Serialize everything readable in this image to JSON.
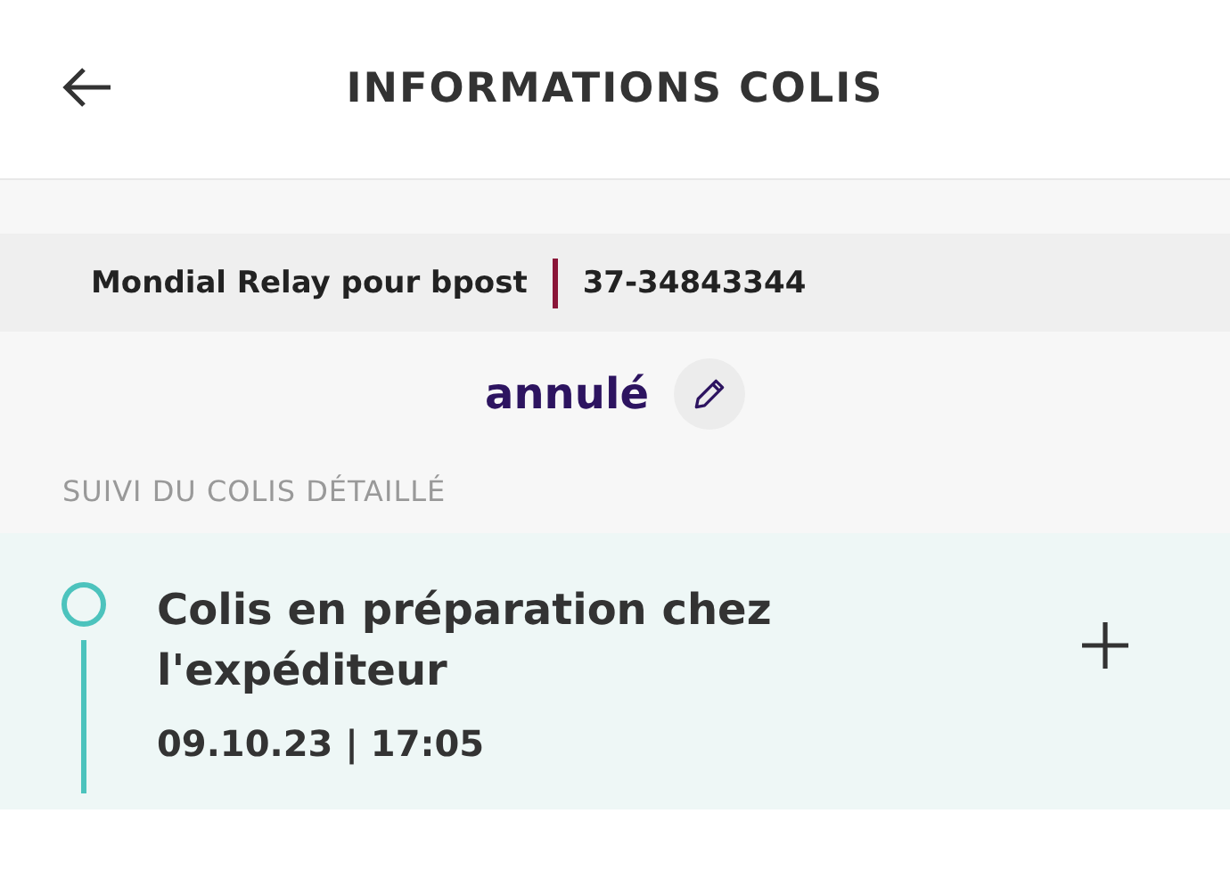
{
  "header": {
    "title": "INFORMATIONS COLIS"
  },
  "shipment": {
    "carrier": "Mondial Relay pour bpost",
    "tracking_number": "37-34843344",
    "status": "annulé"
  },
  "tracking": {
    "section_title": "SUIVI DU COLIS DÉTAILLÉ",
    "events": [
      {
        "title": "Colis en préparation chez l'expéditeur",
        "datetime": "09.10.23 | 17:05",
        "expanded": false
      }
    ]
  }
}
